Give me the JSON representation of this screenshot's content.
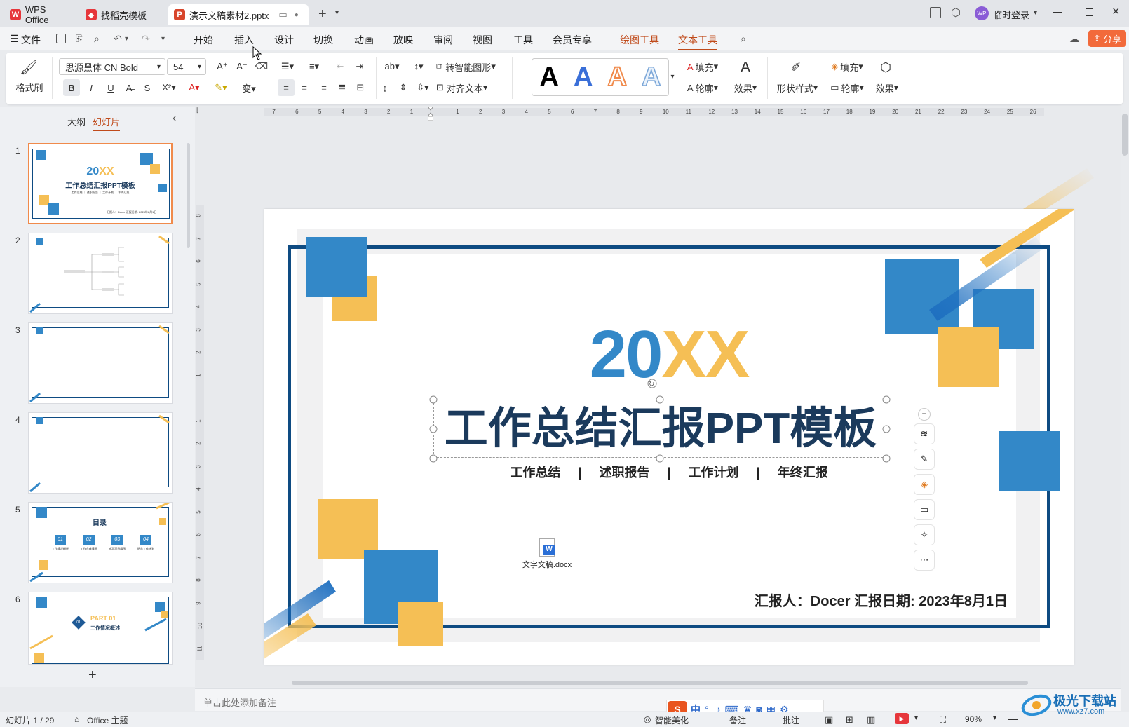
{
  "tabs": [
    {
      "label": "WPS Office"
    },
    {
      "label": "找稻壳模板"
    },
    {
      "label": "演示文稿素材2.pptx"
    }
  ],
  "titlebar": {
    "user": "临时登录",
    "avatar_text": "WP"
  },
  "menu": {
    "file": "文件",
    "items": [
      "开始",
      "插入",
      "设计",
      "切换",
      "动画",
      "放映",
      "审阅",
      "视图",
      "工具",
      "会员专享"
    ],
    "drawing_tools": "绘图工具",
    "text_tools": "文本工具",
    "share": "分享"
  },
  "toolbar": {
    "format_painter": "格式刷",
    "font_name": "思源黑体 CN Bold",
    "font_size": "54",
    "smart_graphic": "转智能图形",
    "align_text": "对齐文本",
    "text_fill": "填充",
    "text_outline": "轮廓",
    "text_effect": "效果",
    "shape_style": "形状样式",
    "shape_fill": "填充",
    "shape_outline": "轮廓",
    "shape_effect": "效果",
    "art_letters": [
      "A",
      "A",
      "A",
      "A"
    ]
  },
  "panel": {
    "outline_tab": "大纲",
    "slides_tab": "幻灯片"
  },
  "thumbnails": [
    {
      "num": "1",
      "title_a": "20",
      "title_b": "XX",
      "subtitle": "工作总结汇报PPT模板",
      "tags": "工作总结 ｜ 述职报告 ｜ 工作计划 ｜ 年终汇报",
      "footer": "汇报人：Docer 汇报日期: 2023年8月1日"
    },
    {
      "num": "2"
    },
    {
      "num": "3"
    },
    {
      "num": "4"
    },
    {
      "num": "5",
      "heading": "目录",
      "items": [
        {
          "n": "01",
          "t": "工作情况概述"
        },
        {
          "n": "02",
          "t": "工作完成情况"
        },
        {
          "n": "03",
          "t": "成功项目展示"
        },
        {
          "n": "04",
          "t": "明年工作计划"
        }
      ]
    },
    {
      "num": "6",
      "part": "PART 01",
      "part_num": "01",
      "part_title": "工作情况概述"
    }
  ],
  "ruler_h": [
    "7",
    "6",
    "5",
    "4",
    "3",
    "2",
    "1",
    "",
    "1",
    "2",
    "3",
    "4",
    "5",
    "6",
    "7",
    "8",
    "9",
    "10",
    "11",
    "12",
    "13",
    "14",
    "15",
    "16",
    "17",
    "18",
    "19",
    "20",
    "21",
    "22",
    "23",
    "24",
    "25",
    "26"
  ],
  "ruler_v": [
    "8",
    "7",
    "6",
    "5",
    "4",
    "3",
    "2",
    "1",
    "",
    "1",
    "2",
    "3",
    "4",
    "5",
    "6",
    "7",
    "8",
    "9",
    "10",
    "11"
  ],
  "slide": {
    "year_a": "20",
    "year_b": "XX",
    "title": "工作总结汇报PPT模板",
    "tags": [
      "工作总结",
      "述职报告",
      "工作计划",
      "年终汇报"
    ],
    "attachment": "文字文稿.docx",
    "footer": "汇报人：Docer  汇报日期: 2023年8月1日"
  },
  "notes_placeholder": "单击此处添加备注",
  "status": {
    "slide_counter": "幻灯片 1 / 29",
    "theme": "Office 主题",
    "smart_beautify": "智能美化",
    "notes": "备注",
    "comments": "批注",
    "zoom": "90%"
  },
  "ime": {
    "lang": "中"
  },
  "watermark": {
    "text": "极光下载站",
    "url": "www.xz7.com"
  },
  "colors": {
    "blue": "#3388c8",
    "yellow": "#f5bf55",
    "navy": "#1b3a5c",
    "frame": "#0e4b82",
    "accent": "#c04a1a",
    "wps_red": "#e6363b"
  }
}
